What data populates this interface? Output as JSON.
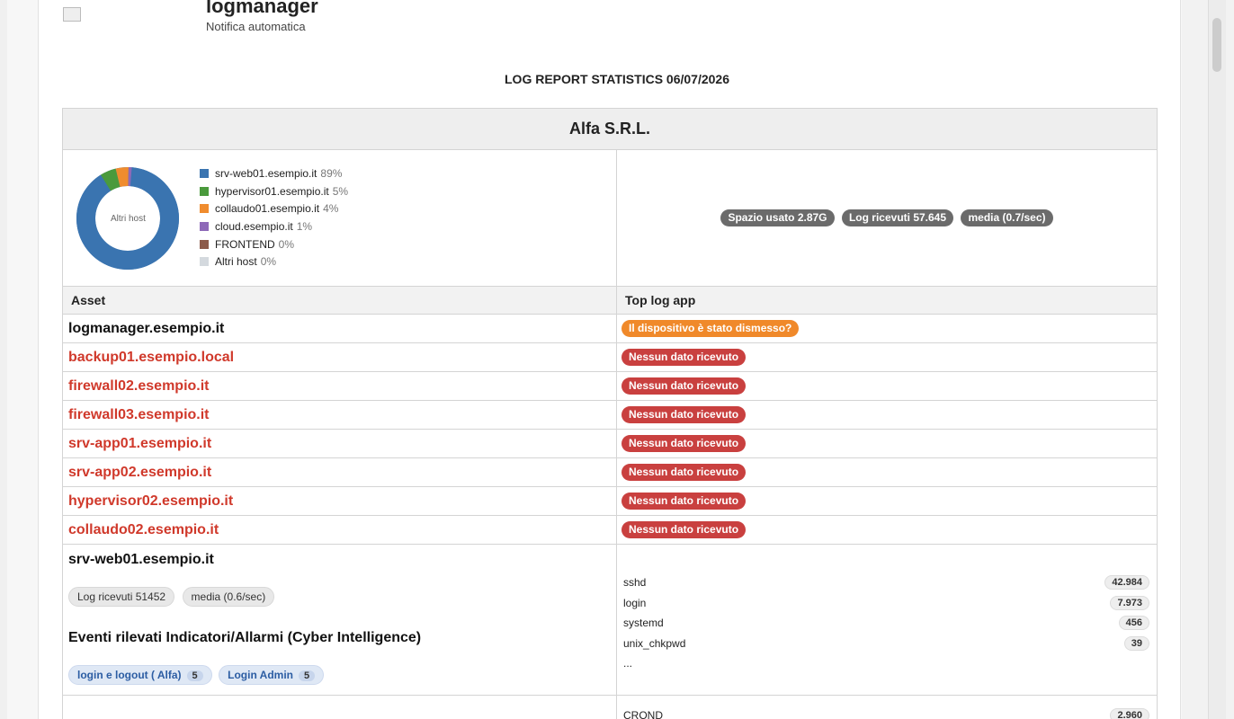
{
  "header": {
    "app_title": "logmanager",
    "app_subtitle": "Notifica automatica"
  },
  "report": {
    "title": "LOG REPORT STATISTICS 06/07/2026",
    "company": "Alfa S.R.L."
  },
  "pie": {
    "center_label": "Altri host",
    "legend": [
      {
        "name": "srv-web01.esempio.it",
        "pct": "89%",
        "value": 89,
        "color": "#3a74b0"
      },
      {
        "name": "hypervisor01.esempio.it",
        "pct": "5%",
        "value": 5,
        "color": "#4a9a3c"
      },
      {
        "name": "collaudo01.esempio.it",
        "pct": "4%",
        "value": 4,
        "color": "#f08c2e"
      },
      {
        "name": "cloud.esempio.it",
        "pct": "1%",
        "value": 1,
        "color": "#8e69b8"
      },
      {
        "name": "FRONTEND",
        "pct": "0%",
        "value": 0,
        "color": "#8c5b4a"
      },
      {
        "name": "Altri host",
        "pct": "0%",
        "value": 0,
        "color": "#d4d9de"
      }
    ]
  },
  "summary": {
    "space": "Spazio usato 2.87G",
    "logs": "Log ricevuti 57.645",
    "rate": "media (0.7/sec)"
  },
  "columns": {
    "asset": "Asset",
    "top_app": "Top log app"
  },
  "assets": [
    {
      "name": "logmanager.esempio.it",
      "status": "Il dispositivo è stato dismesso?"
    },
    {
      "name": "backup01.esempio.local",
      "status": "Nessun dato ricevuto"
    },
    {
      "name": "firewall02.esempio.it",
      "status": "Nessun dato ricevuto"
    },
    {
      "name": "firewall03.esempio.it",
      "status": "Nessun dato ricevuto"
    },
    {
      "name": "srv-app01.esempio.it",
      "status": "Nessun dato ricevuto"
    },
    {
      "name": "srv-app02.esempio.it",
      "status": "Nessun dato ricevuto"
    },
    {
      "name": "hypervisor02.esempio.it",
      "status": "Nessun dato ricevuto"
    },
    {
      "name": "collaudo02.esempio.it",
      "status": "Nessun dato ricevuto"
    }
  ],
  "detail": {
    "host": "srv-web01.esempio.it",
    "logs": "Log ricevuti 51452",
    "rate": "media (0.6/sec)",
    "events_title": "Eventi rilevati Indicatori/Allarmi (Cyber Intelligence)",
    "events": [
      {
        "label": "login e logout ( Alfa)",
        "count": "5"
      },
      {
        "label": "Login Admin",
        "count": "5"
      }
    ],
    "apps": [
      {
        "name": "sshd",
        "count": "42.984"
      },
      {
        "name": "login",
        "count": "7.973"
      },
      {
        "name": "systemd",
        "count": "456"
      },
      {
        "name": "unix_chkpwd",
        "count": "39"
      }
    ],
    "more": "..."
  },
  "next": {
    "app": "CROND",
    "count": "2.960"
  }
}
